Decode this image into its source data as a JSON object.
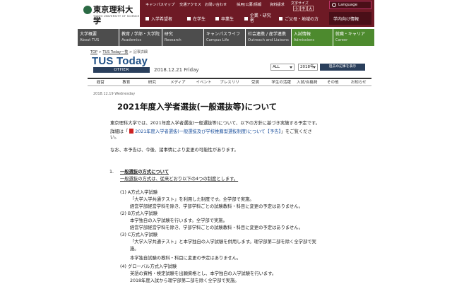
{
  "header": {
    "logo_text": "東京理科大学",
    "logo_sub": "TOKYO UNIVERSITY OF SCIENCE",
    "utility_links": [
      "キャンパスマップ",
      "交通アクセス",
      "お問い合わせ",
      "採用(公募)情報",
      "資料請求"
    ],
    "font_size_label": "文字サイズ",
    "font_sizes": [
      "小",
      "中",
      "大"
    ],
    "language_button": "Language",
    "audience_links": [
      "入学希望者",
      "在学生",
      "卒業生",
      "企業・研究者",
      "ご父母・地域の方",
      "学内向け情報"
    ]
  },
  "main_nav": [
    {
      "jp": "大学概要",
      "en": "About TUS",
      "active": false
    },
    {
      "jp": "教育 / 学部・大学院",
      "en": "Academics",
      "active": false
    },
    {
      "jp": "研究",
      "en": "Research",
      "active": false
    },
    {
      "jp": "キャンパスライフ",
      "en": "Campus Life",
      "active": false
    },
    {
      "jp": "社会連携 / 産学連携",
      "en": "Outreach and Liaisons",
      "active": false
    },
    {
      "jp": "入試情報",
      "en": "Admissions",
      "active": true
    },
    {
      "jp": "就職・キャリア",
      "en": "Career",
      "active": false
    }
  ],
  "breadcrumb": {
    "top": "TOP",
    "sep": ">",
    "list": "TUS Today一覧",
    "current": "記事詳細"
  },
  "tus_today": {
    "title": "TUS Today",
    "category": "OTHER",
    "date": "2018.12.21 Friday",
    "select_all": "ALL",
    "select_year": "2018年",
    "past_button": "過去の記事を表示"
  },
  "categories": [
    "経営",
    "教育",
    "研究",
    "メディア",
    "イベント",
    "プレスリリ",
    "受賞",
    "学生の活躍",
    "入試/合格発",
    "その他",
    "お知らせ"
  ],
  "article": {
    "post_date": "2018.12.19 Wednesday",
    "title": "2021年度入学者選抜(一般選抜等)について",
    "intro": "東京理科大学では、2021年度入学者選抜(一般選抜等)について、以下の方針に基づき実施する予定です。",
    "detail_prefix": "詳細は「",
    "detail_link": "2021年度入学者選抜(一般選抜及び学校推薦型選抜制度)について【予告】",
    "detail_suffix": "」をご覧くださ",
    "detail_line2": "い。",
    "note": "なお、本予告は、今後、諸事情により変更の可能性があります。",
    "section1_num": "1.",
    "section1_heading": "一般選抜の方式について",
    "section1_lead": "一般選抜の方式は、従来どおり以下の4つの制度とします。",
    "items": [
      "(1) A方式入学試験",
      "「大学入学共通テスト」を利用した制度です。全学部で実施。",
      "経営学部経営学科を除き、学部学科ごとの試験教科・科目に変更の予定はありません。",
      "(2) B方式入学試験",
      "本学独自の入学試験を行います。全学部で実施。",
      "経営学部経営学科を除き、学部学科ごとの試験教科・科目に変更の予定はありません。",
      "(3) C方式入学試験",
      "「大学入学共通テスト」と本学独自の入学試験を併用します。理学部第二部を除く全学部で実",
      "施。",
      "本学独自試験の教科・科目に変更の予定はありません。",
      "(4) グローバル方式入学試験",
      "英語の資格・検定試験を出願資格とし、本学独自の入学試験を行います。",
      "2018年度入試から理学部第二部を除く全学部で実施。"
    ]
  },
  "colors": {
    "header_bg": "#6e1a25",
    "nav_bg": "#4d4d4d",
    "nav_active": "#4d8a2e",
    "tus_blue": "#1e4f85",
    "link": "#1a4f9c"
  }
}
